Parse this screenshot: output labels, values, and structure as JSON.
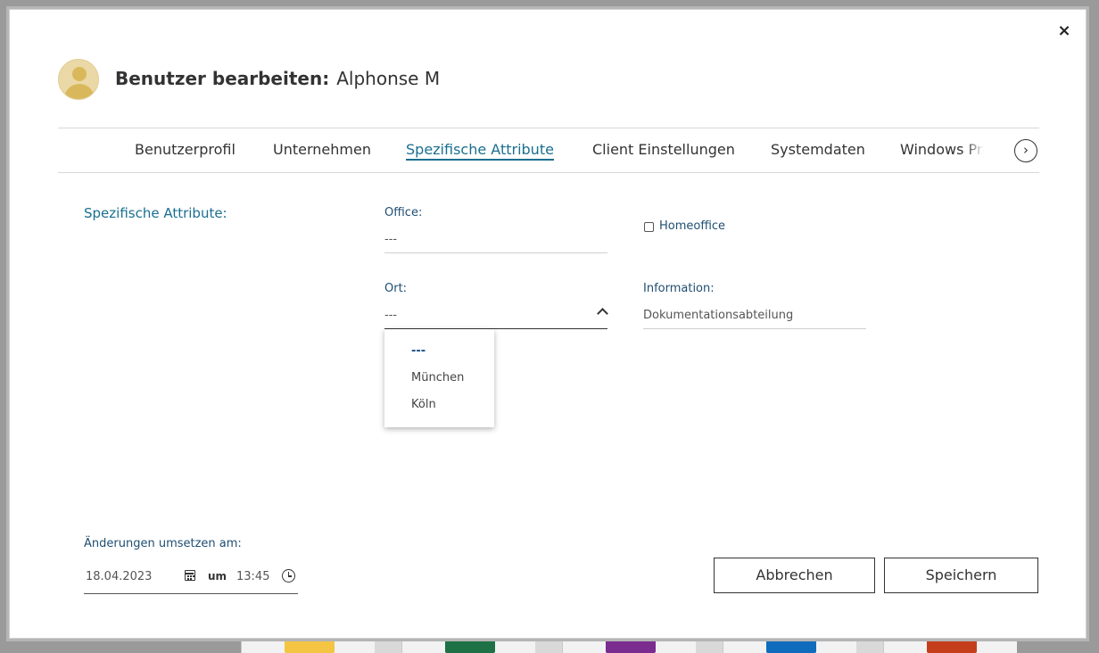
{
  "dialog": {
    "close_symbol": "×",
    "title_prefix": "Benutzer bearbeiten:",
    "user_name": "Alphonse M"
  },
  "tabs": [
    {
      "label": "Benutzerprofil",
      "active": false
    },
    {
      "label": "Unternehmen",
      "active": false
    },
    {
      "label": "Spezifische Attribute",
      "active": true
    },
    {
      "label": "Client Einstellungen",
      "active": false
    },
    {
      "label": "Systemdaten",
      "active": false
    },
    {
      "label": "Windows Profil",
      "active": false
    }
  ],
  "tabs_next_symbol": "›",
  "section": {
    "label": "Spezifische Attribute:"
  },
  "fields": {
    "office": {
      "label": "Office:",
      "value": "---"
    },
    "ort": {
      "label": "Ort:",
      "value": "---"
    },
    "homeoffice": {
      "label": "Homeoffice",
      "checked": false
    },
    "information": {
      "label": "Information:",
      "value": "Dokumentationsabteilung"
    }
  },
  "ort_dropdown": {
    "options": [
      "---",
      "München",
      "Köln"
    ],
    "selected": "---"
  },
  "footer": {
    "label": "Änderungen umsetzen am:",
    "date": "18.04.2023",
    "um": "um",
    "time": "13:45",
    "cancel_label": "Abbrechen",
    "save_label": "Speichern"
  },
  "colors": {
    "accent": "#1a6f90",
    "label": "#1f4e72"
  }
}
